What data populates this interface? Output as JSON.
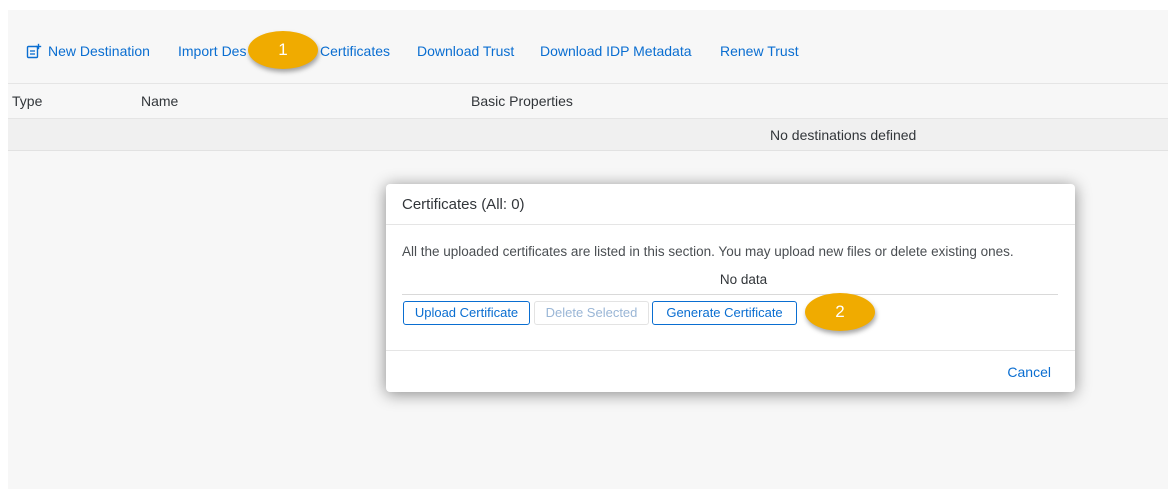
{
  "toolbar": {
    "new_destination": "New Destination",
    "import_destination": "Import Des",
    "certificates": "Certificates",
    "download_trust": "Download Trust",
    "download_idp_metadata": "Download IDP Metadata",
    "renew_trust": "Renew Trust"
  },
  "table": {
    "columns": [
      "Type",
      "Name",
      "Basic Properties"
    ],
    "empty_message": "No destinations defined"
  },
  "callouts": [
    "1",
    "2"
  ],
  "dialog": {
    "title": "Certificates (All: 0)",
    "info": "All the uploaded certificates are listed in this section. You may upload new files or delete existing ones.",
    "no_data": "No data",
    "buttons": {
      "upload": "Upload Certificate",
      "delete": "Delete Selected",
      "generate": "Generate Certificate"
    },
    "cancel": "Cancel"
  },
  "colors": {
    "accent": "#0a6ed1",
    "callout": "#f0ab00",
    "background": "#f7f7f7"
  },
  "icons": {
    "new_destination": "new-document-icon"
  }
}
